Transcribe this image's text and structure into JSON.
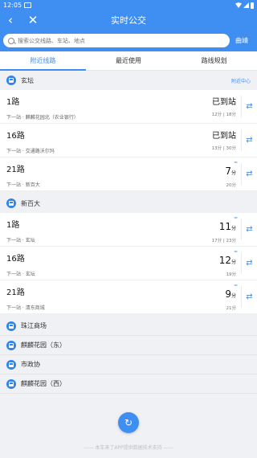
{
  "status": {
    "time": "12:05"
  },
  "header": {
    "title": "实时公交",
    "back_icon": "‹",
    "close_icon": "✕",
    "search_placeholder": "搜索公交线路、车站、地点",
    "city": "曲靖"
  },
  "tabs": [
    {
      "label": "附近线路",
      "active": true
    },
    {
      "label": "最近使用",
      "active": false
    },
    {
      "label": "路线规划",
      "active": false
    }
  ],
  "stations": [
    {
      "name": "玄坛",
      "link": "附近中心",
      "routes": [
        {
          "name": "1路",
          "next": "下一站 · 麒麟花园北（农业银行）",
          "status": "已到站",
          "detail": "12分 | 18分"
        },
        {
          "name": "16路",
          "next": "下一站 · 交通路沃尔玛",
          "status": "已到站",
          "detail": "13分 | 30分"
        },
        {
          "name": "21路",
          "next": "下一站 · 新百大",
          "eta_num": "7",
          "eta_unit": "分",
          "detail": "20分"
        }
      ]
    },
    {
      "name": "新百大",
      "routes": [
        {
          "name": "1路",
          "next": "下一站 · 玄坛",
          "eta_num": "11",
          "eta_unit": "分",
          "detail": "17分 | 23分"
        },
        {
          "name": "16路",
          "next": "下一站 · 玄坛",
          "eta_num": "12",
          "eta_unit": "分",
          "detail": "19分"
        },
        {
          "name": "21路",
          "next": "下一站 · 清东商城",
          "eta_num": "9",
          "eta_unit": "分",
          "detail": "21分"
        }
      ]
    }
  ],
  "collapsed_stations": [
    "珠江商场",
    "麒麟花园（东）",
    "市政协",
    "麒麟花园（西）"
  ],
  "footer": "—— 本车来了APP提供数据技术支持 ——",
  "icons": {
    "refresh": "↻",
    "swap": "⇄",
    "signal": "≈"
  },
  "colors": {
    "accent": "#3f8ff2"
  }
}
